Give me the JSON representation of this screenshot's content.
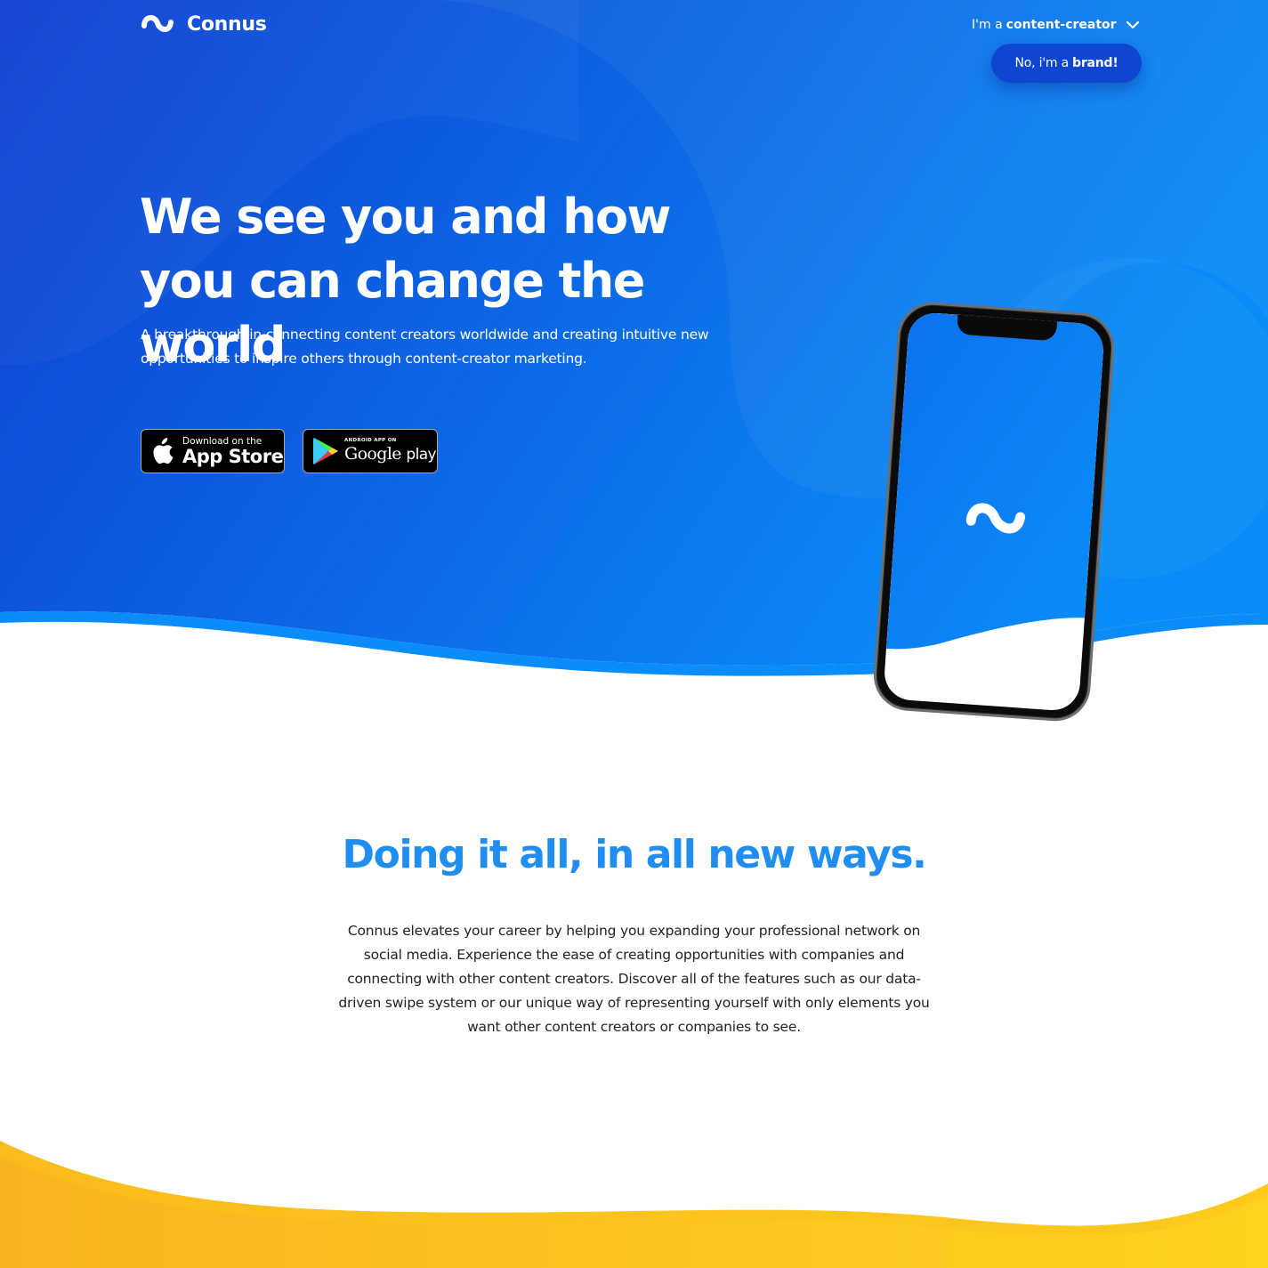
{
  "brand": {
    "name": "Connus",
    "colors": {
      "hero_gradient_start": "#0f3fd0",
      "hero_gradient_end": "#0a8df8",
      "wave_accent": "#0a8cf9",
      "heading_blue": "#1f8ef0",
      "yellow": "#fcc21c",
      "button_dark_blue": "#0f46d1"
    }
  },
  "header": {
    "logo_icon": "connus-wave-icon",
    "role_selector": {
      "prefix": "I'm a",
      "role": "content-creator",
      "icon": "chevron-down-icon"
    },
    "switch_button": {
      "prefix": "No, i'm a",
      "bold": "brand!"
    }
  },
  "hero": {
    "title": "We see you and how you can change the world",
    "subtitle": "A breakthrough in connecting content creators worldwide and creating intuitive new opportunities to inspire others through content-creator marketing.",
    "app_store": {
      "small": "Download on the",
      "big": "App Store",
      "icon": "apple-icon"
    },
    "google_play": {
      "small": "ANDROID APP ON",
      "big": "Google",
      "big_suffix": "play",
      "icon": "google-play-icon"
    }
  },
  "section2": {
    "title": "Doing it all, in all new ways.",
    "body": "Connus elevates your career by helping you expanding your professional network on social media. Experience the ease of creating opportunities with companies and connecting with other content creators. Discover all of the features such as our data-driven swipe system or our unique way of representing yourself with only elements you want other content creators or companies to see."
  }
}
